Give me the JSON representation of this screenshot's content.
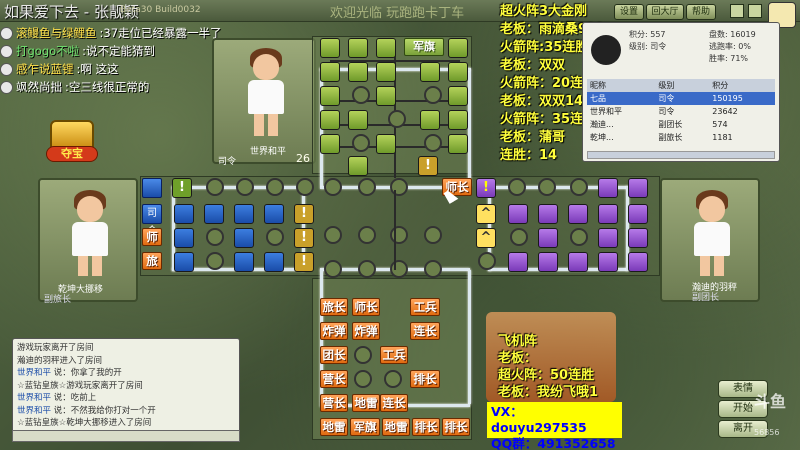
{
  "window": {
    "title": "如果爱下去 - 张靓颖",
    "build": "Beta30 Build0032",
    "center_text": "欢迎光临 玩跑跑卡丁车",
    "buttons": [
      "设置",
      "回大厅",
      "帮助"
    ]
  },
  "chat_top": [
    {
      "name": "滚鳗鱼与绿鲤鱼",
      "msg": ":37走位已经暴露一半了"
    },
    {
      "name": "打gogo不啦",
      "msg": ":说不定能猜到",
      "green": true
    },
    {
      "name": "感乍说蓝锂",
      "msg": ":啊  这这"
    },
    {
      "name": "飒然尚拙",
      "msg": ":空三线很正常的"
    }
  ],
  "overlay_streamer": [
    "超火阵3大金刚",
    "老板：雨滴桑988",
    "火箭阵:35连胜",
    "老板：双双",
    "火箭阵：20连胜（阿7+双）2次",
    "老板：双双14",
    "火箭阵：35连",
    "老板：蒲哥",
    "连胜：14"
  ],
  "overlay_bottom": [
    "飞机阵",
    "老板：",
    "超火阵：50连胜",
    "老板：我纷飞哦1"
  ],
  "contact": {
    "vx": "VX：douyu297535",
    "qq": "QQ群：491352658"
  },
  "treasure_label": "夺宝",
  "players": {
    "top": {
      "name": "世界和平",
      "rank": "司令",
      "level": "26"
    },
    "left": {
      "name": "乾坤大挪移",
      "rank": "副旅长"
    },
    "right": {
      "name": "瀚迪的羽秤",
      "rank": "副团长"
    }
  },
  "stats": {
    "labels": {
      "points": "积分",
      "rank": "级别",
      "won": "盘数",
      "level": "级别",
      "escape": "逃跑率",
      "win": "胜率"
    },
    "values": {
      "points": "557",
      "rank": "司令",
      "won": "16019",
      "escape": "0%",
      "win": "71%"
    },
    "headers": [
      "昵称",
      "级别",
      "积分"
    ],
    "rows": [
      {
        "name": "七品",
        "rank": "司令",
        "score": "150195",
        "highlight": true
      },
      {
        "name": "世界和平",
        "rank": "司令",
        "score": "23642"
      },
      {
        "name": "瀚迪...",
        "rank": "副团长",
        "score": "574"
      },
      {
        "name": "乾坤...",
        "rank": "副旅长",
        "score": "1181"
      }
    ]
  },
  "chat_log": [
    {
      "text": "游戏玩家离开了房间"
    },
    {
      "text": "瀚迪的羽秤进入了房间"
    },
    {
      "name": "世界和平",
      "text": "说：你拿了我的开"
    },
    {
      "text": "☆蓝钻皇族☆游戏玩家离开了房间"
    },
    {
      "name": "世界和平",
      "text": "说：吃前上"
    },
    {
      "name": "世界和平",
      "text": "说：不然我给你打对一个开"
    },
    {
      "text": "☆蓝钻皇族☆乾坤大挪移进入了房间"
    }
  ],
  "board": {
    "top_flag": "军旗",
    "mid_piece": "师长",
    "bottom_pieces": [
      [
        "旅长",
        "师长",
        "工兵"
      ],
      [
        "炸弹",
        "炸弹",
        "连长"
      ],
      [
        "团长",
        "工兵"
      ],
      [
        "营长",
        "排长"
      ],
      [
        "营长",
        "地雷",
        "连长"
      ],
      [
        "地雷",
        "军旗",
        "地雷",
        "排长",
        "排长"
      ]
    ],
    "blue_labels": [
      "司令",
      "师",
      "旅"
    ]
  },
  "controls": {
    "emote": "表情",
    "start": "开始",
    "leave": "离开"
  },
  "watermark": "斗鱼",
  "watermark_id": "56856"
}
